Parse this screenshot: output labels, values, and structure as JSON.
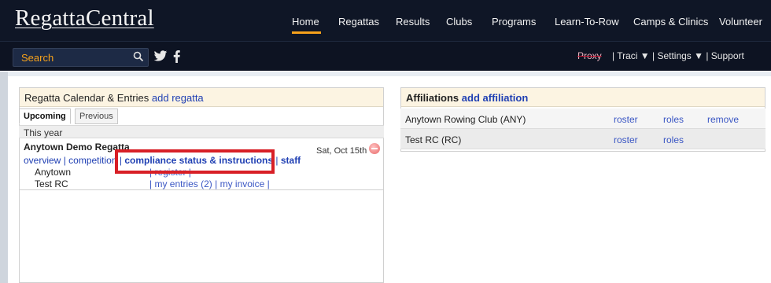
{
  "header": {
    "logo": "RegattaCentral",
    "nav": [
      {
        "label": "Home",
        "active": true
      },
      {
        "label": "Regattas"
      },
      {
        "label": "Results"
      },
      {
        "label": "Clubs"
      },
      {
        "label": "Programs"
      },
      {
        "label": "Learn-To-Row"
      },
      {
        "label": "Camps & Clinics"
      },
      {
        "label": "Volunteer"
      }
    ],
    "accent_color": "#f7a21b"
  },
  "subbar": {
    "search_label": "Search",
    "search_icon": "search-icon",
    "social": [
      "twitter-icon",
      "facebook-icon"
    ],
    "proxy": "Proxy",
    "user_links": "| Traci ▼ | Settings ▼ | Support"
  },
  "calendar": {
    "title": "Regatta Calendar & Entries",
    "add_link": "add regatta",
    "tabs": [
      "Upcoming",
      "Previous"
    ],
    "active_tab": "Upcoming",
    "section": "This year",
    "regatta": {
      "name": "Anytown Demo Regatta",
      "date": "Sat, Oct 15th",
      "links": {
        "overview": "overview",
        "competition": "competition",
        "compliance": "compliance status & instructions",
        "staff": "staff"
      },
      "clubs": [
        {
          "name": "Anytown",
          "links": "| register |"
        },
        {
          "name": "Test RC",
          "links": "| my entries (2) | my invoice |"
        }
      ]
    }
  },
  "affiliations": {
    "title": "Affiliations",
    "add_link": "add affiliation",
    "rows": [
      {
        "club": "Anytown Rowing Club (ANY)",
        "roster": "roster",
        "roles": "roles",
        "remove": "remove"
      },
      {
        "club": "Test RC (RC)",
        "roster": "roster",
        "roles": "roles"
      }
    ]
  },
  "highlight_color": "#d81f26"
}
